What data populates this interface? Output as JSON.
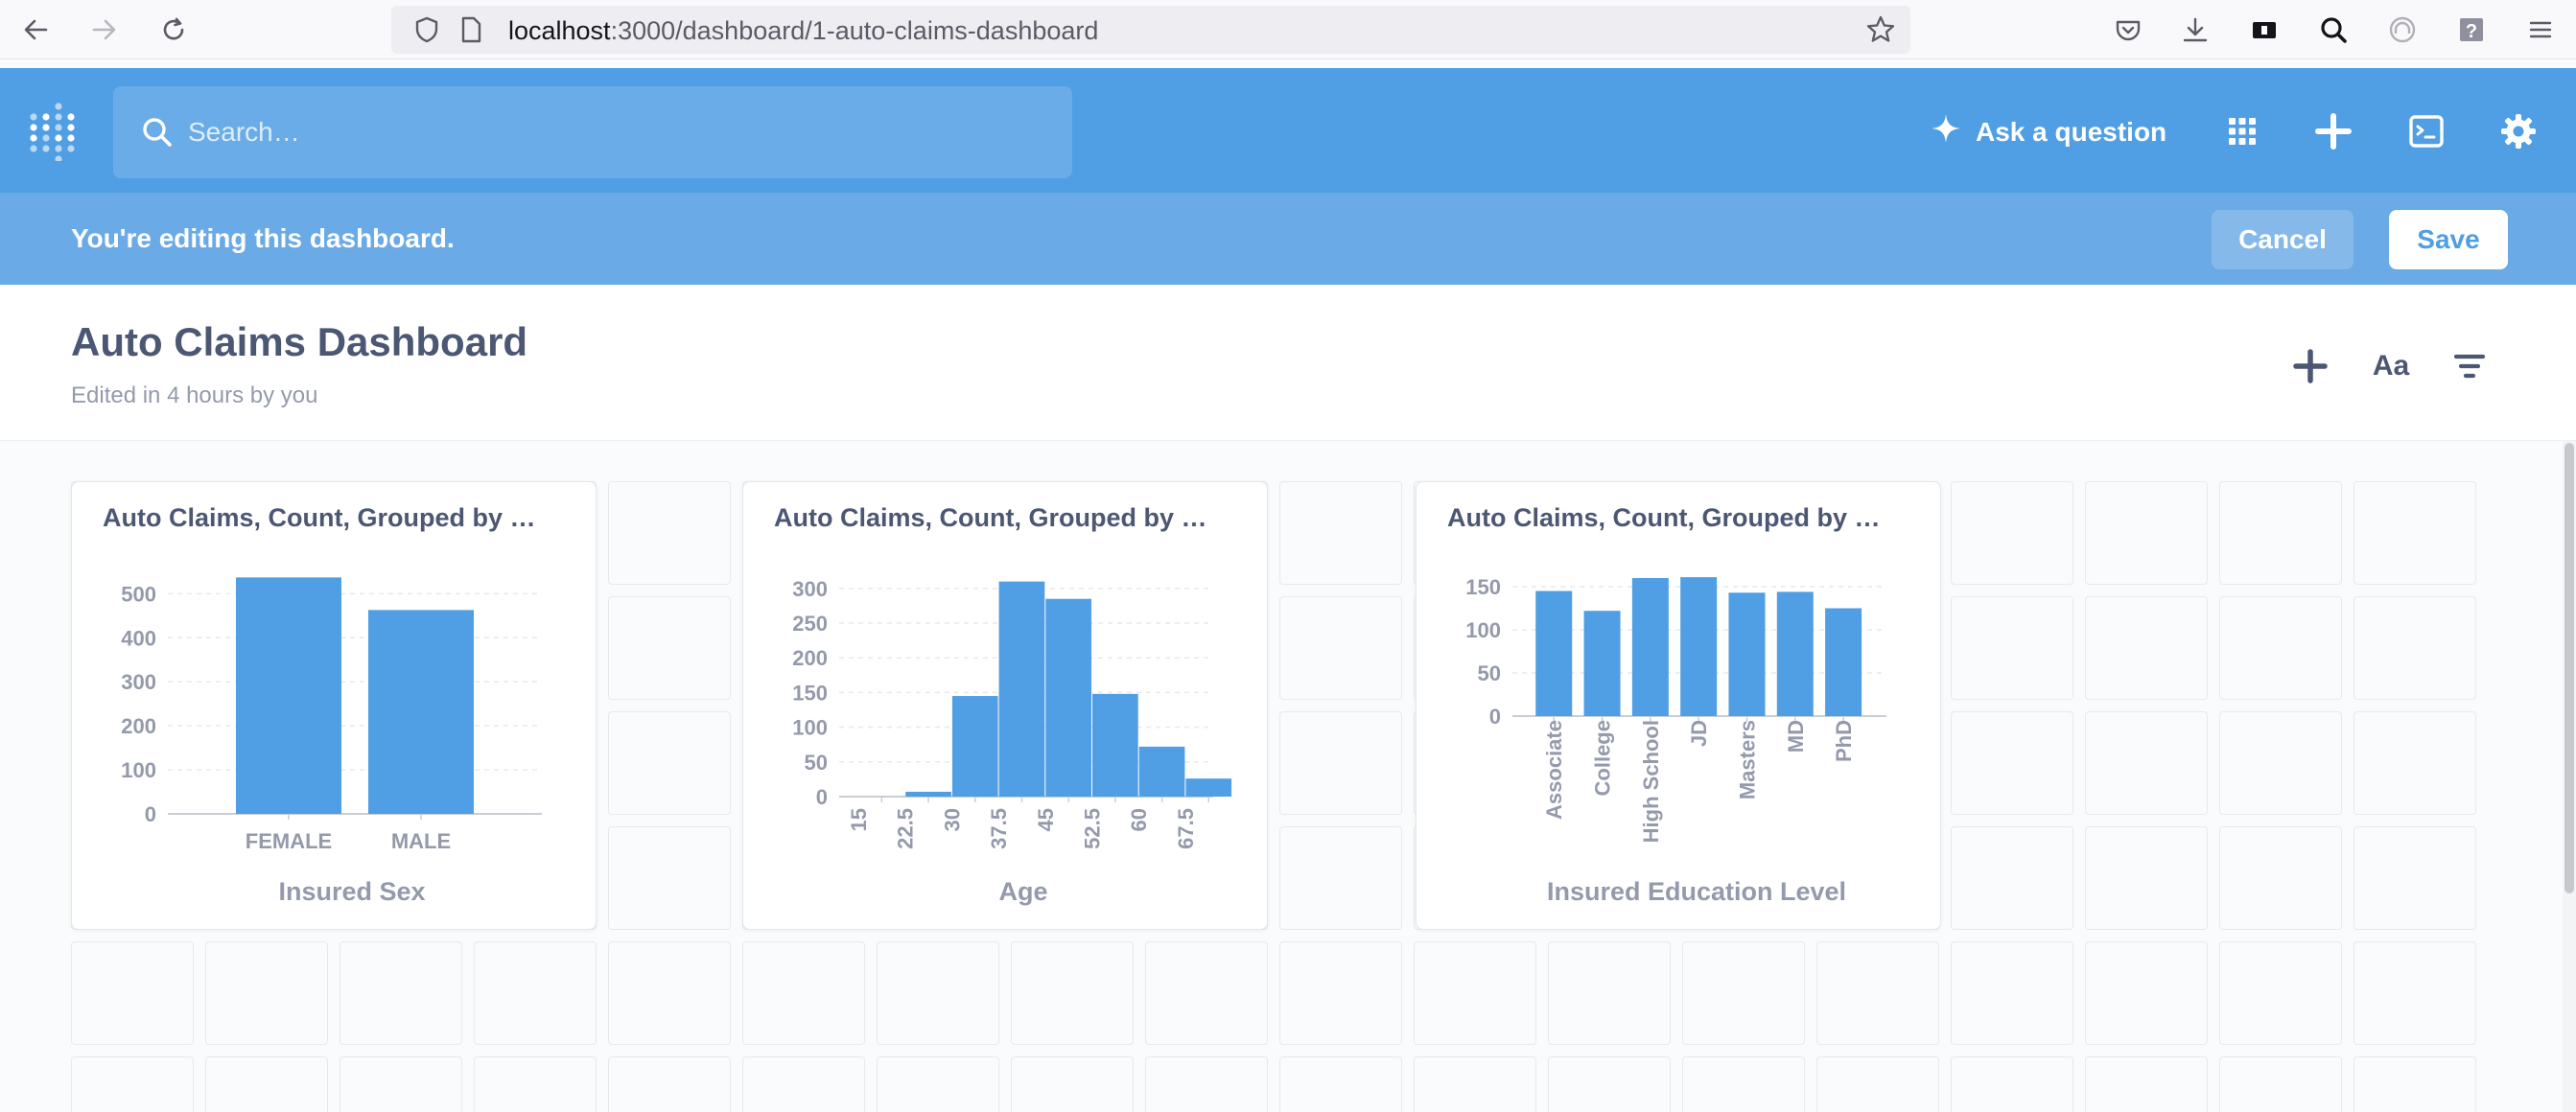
{
  "browser": {
    "url_host": "localhost",
    "url_path": ":3000/dashboard/1-auto-claims-dashboard"
  },
  "nav": {
    "search_placeholder": "Search…",
    "ask_label": "Ask a question",
    "accent": "#509ee3"
  },
  "editbar": {
    "message": "You're editing this dashboard.",
    "cancel_label": "Cancel",
    "save_label": "Save"
  },
  "dashboard": {
    "title": "Auto Claims Dashboard",
    "subtitle": "Edited in 4 hours by you",
    "text_icon_label": "Aa"
  },
  "cards": [
    {
      "title": "Auto Claims, Count, Grouped by …"
    },
    {
      "title": "Auto Claims, Count, Grouped by …"
    },
    {
      "title": "Auto Claims, Count, Grouped by …"
    }
  ],
  "chart_data": [
    {
      "type": "bar",
      "categories": [
        "FEMALE",
        "MALE"
      ],
      "values": [
        537,
        463
      ],
      "xlabel": "Insured Sex",
      "ylabel": "",
      "yticks": [
        0,
        100,
        200,
        300,
        400,
        500
      ],
      "ylim": [
        0,
        540
      ],
      "grid": true,
      "color": "#509ee3"
    },
    {
      "type": "bar",
      "categories": [
        "15",
        "22.5",
        "30",
        "37.5",
        "45",
        "52.5",
        "60",
        "67.5"
      ],
      "values": [
        0,
        7,
        145,
        310,
        285,
        148,
        72,
        26
      ],
      "xlabel": "Age",
      "ylabel": "",
      "yticks": [
        0,
        50,
        100,
        150,
        200,
        250,
        300
      ],
      "ylim": [
        0,
        315
      ],
      "grid": true,
      "color": "#509ee3"
    },
    {
      "type": "bar",
      "categories": [
        "Associate",
        "College",
        "High School",
        "JD",
        "Masters",
        "MD",
        "PhD"
      ],
      "values": [
        145,
        122,
        160,
        161,
        143,
        144,
        125
      ],
      "xlabel": "Insured Education Level",
      "ylabel": "",
      "yticks": [
        0,
        50,
        100,
        150
      ],
      "ylim": [
        0,
        160
      ],
      "grid": true,
      "color": "#509ee3"
    }
  ]
}
